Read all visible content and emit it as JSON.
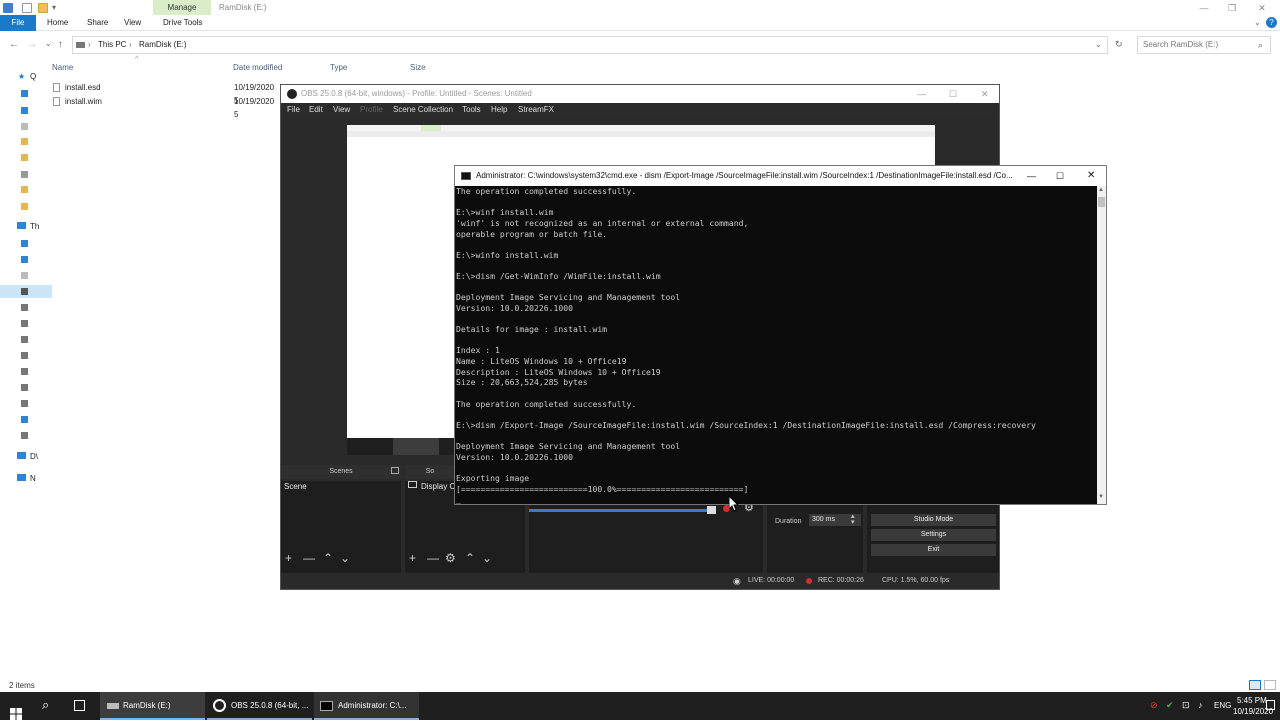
{
  "explorer": {
    "window_title": "RamDisk (E:)",
    "ribbon_tabs": {
      "file": "File",
      "home": "Home",
      "share": "Share",
      "view": "View",
      "drive_tools": "Drive Tools"
    },
    "contextual_tab": "Manage",
    "address_parts": {
      "root": "This PC",
      "drive": "RamDisk (E:)"
    },
    "address_separator": "›",
    "search_placeholder": "Search RamDisk (E:)",
    "columns": {
      "name": "Name",
      "date_modified": "Date modified",
      "type": "Type",
      "size": "Size"
    },
    "files": [
      {
        "name": "install.esd",
        "date": "10/19/2020 5"
      },
      {
        "name": "install.wim",
        "date": "10/19/2020 5"
      }
    ],
    "nav_pane_labels": {
      "quick_access": "Q",
      "this_pc": "Th",
      "dvd": "D\\",
      "network": "N"
    },
    "status": "2 items",
    "help_glyph": "?"
  },
  "obs": {
    "window_title": "OBS 25.0.8 (64-bit, windows) - Profile: Untitled - Scenes: Untitled",
    "menu": {
      "file": "File",
      "edit": "Edit",
      "view": "View",
      "profile": "Profile",
      "scene_collection": "Scene Collection",
      "tools": "Tools",
      "help": "Help",
      "streamfx": "StreamFX"
    },
    "docks": {
      "scenes_title": "Scenes",
      "sources_title_partial": "So"
    },
    "scenes": [
      "Scene"
    ],
    "sources": [
      "Display Ca"
    ],
    "duration_label": "Duration",
    "duration_value": "300 ms",
    "buttons": {
      "studio_mode": "Studio Mode",
      "settings": "Settings",
      "exit": "Exit"
    },
    "status": {
      "live": "LIVE: 00:00:00",
      "rec": "REC: 00:00:26",
      "cpu": "CPU: 1.5%, 60.00 fps"
    },
    "colors": {
      "rec_dot": "#d32f2f",
      "volume_bar": "#2f7ed8"
    }
  },
  "cmd": {
    "window_title": "Administrator: C:\\windows\\system32\\cmd.exe - dism  /Export-Image /SourceImageFile:install.wim /SourceIndex:1 /DestinationImageFile:install.esd /Co...",
    "lines": [
      "The operation completed successfully.",
      "",
      "E:\\>winf install.wim",
      "'winf' is not recognized as an internal or external command,",
      "operable program or batch file.",
      "",
      "E:\\>winfo install.wim",
      "",
      "E:\\>dism /Get-WimInfo /WimFile:install.wim",
      "",
      "Deployment Image Servicing and Management tool",
      "Version: 10.0.20226.1000",
      "",
      "Details for image : install.wim",
      "",
      "Index : 1",
      "Name : LiteOS Windows 10 + Office19",
      "Description : LiteOS Windows 10 + Office19",
      "Size : 20,663,524,285 bytes",
      "",
      "The operation completed successfully.",
      "",
      "E:\\>dism /Export-Image /SourceImageFile:install.wim /SourceIndex:1 /DestinationImageFile:install.esd /Compress:recovery",
      "",
      "Deployment Image Servicing and Management tool",
      "Version: 10.0.20226.1000",
      "",
      "Exporting image",
      "[==========================100.0%==========================]",
      "_"
    ]
  },
  "taskbar": {
    "apps": [
      {
        "label": "RamDisk (E:)"
      },
      {
        "label": "OBS 25.0.8 (64-bit, ..."
      },
      {
        "label": "Administrator: C:\\..."
      }
    ],
    "language": "ENG",
    "time": "5:45 PM",
    "date": "10/19/2020"
  }
}
